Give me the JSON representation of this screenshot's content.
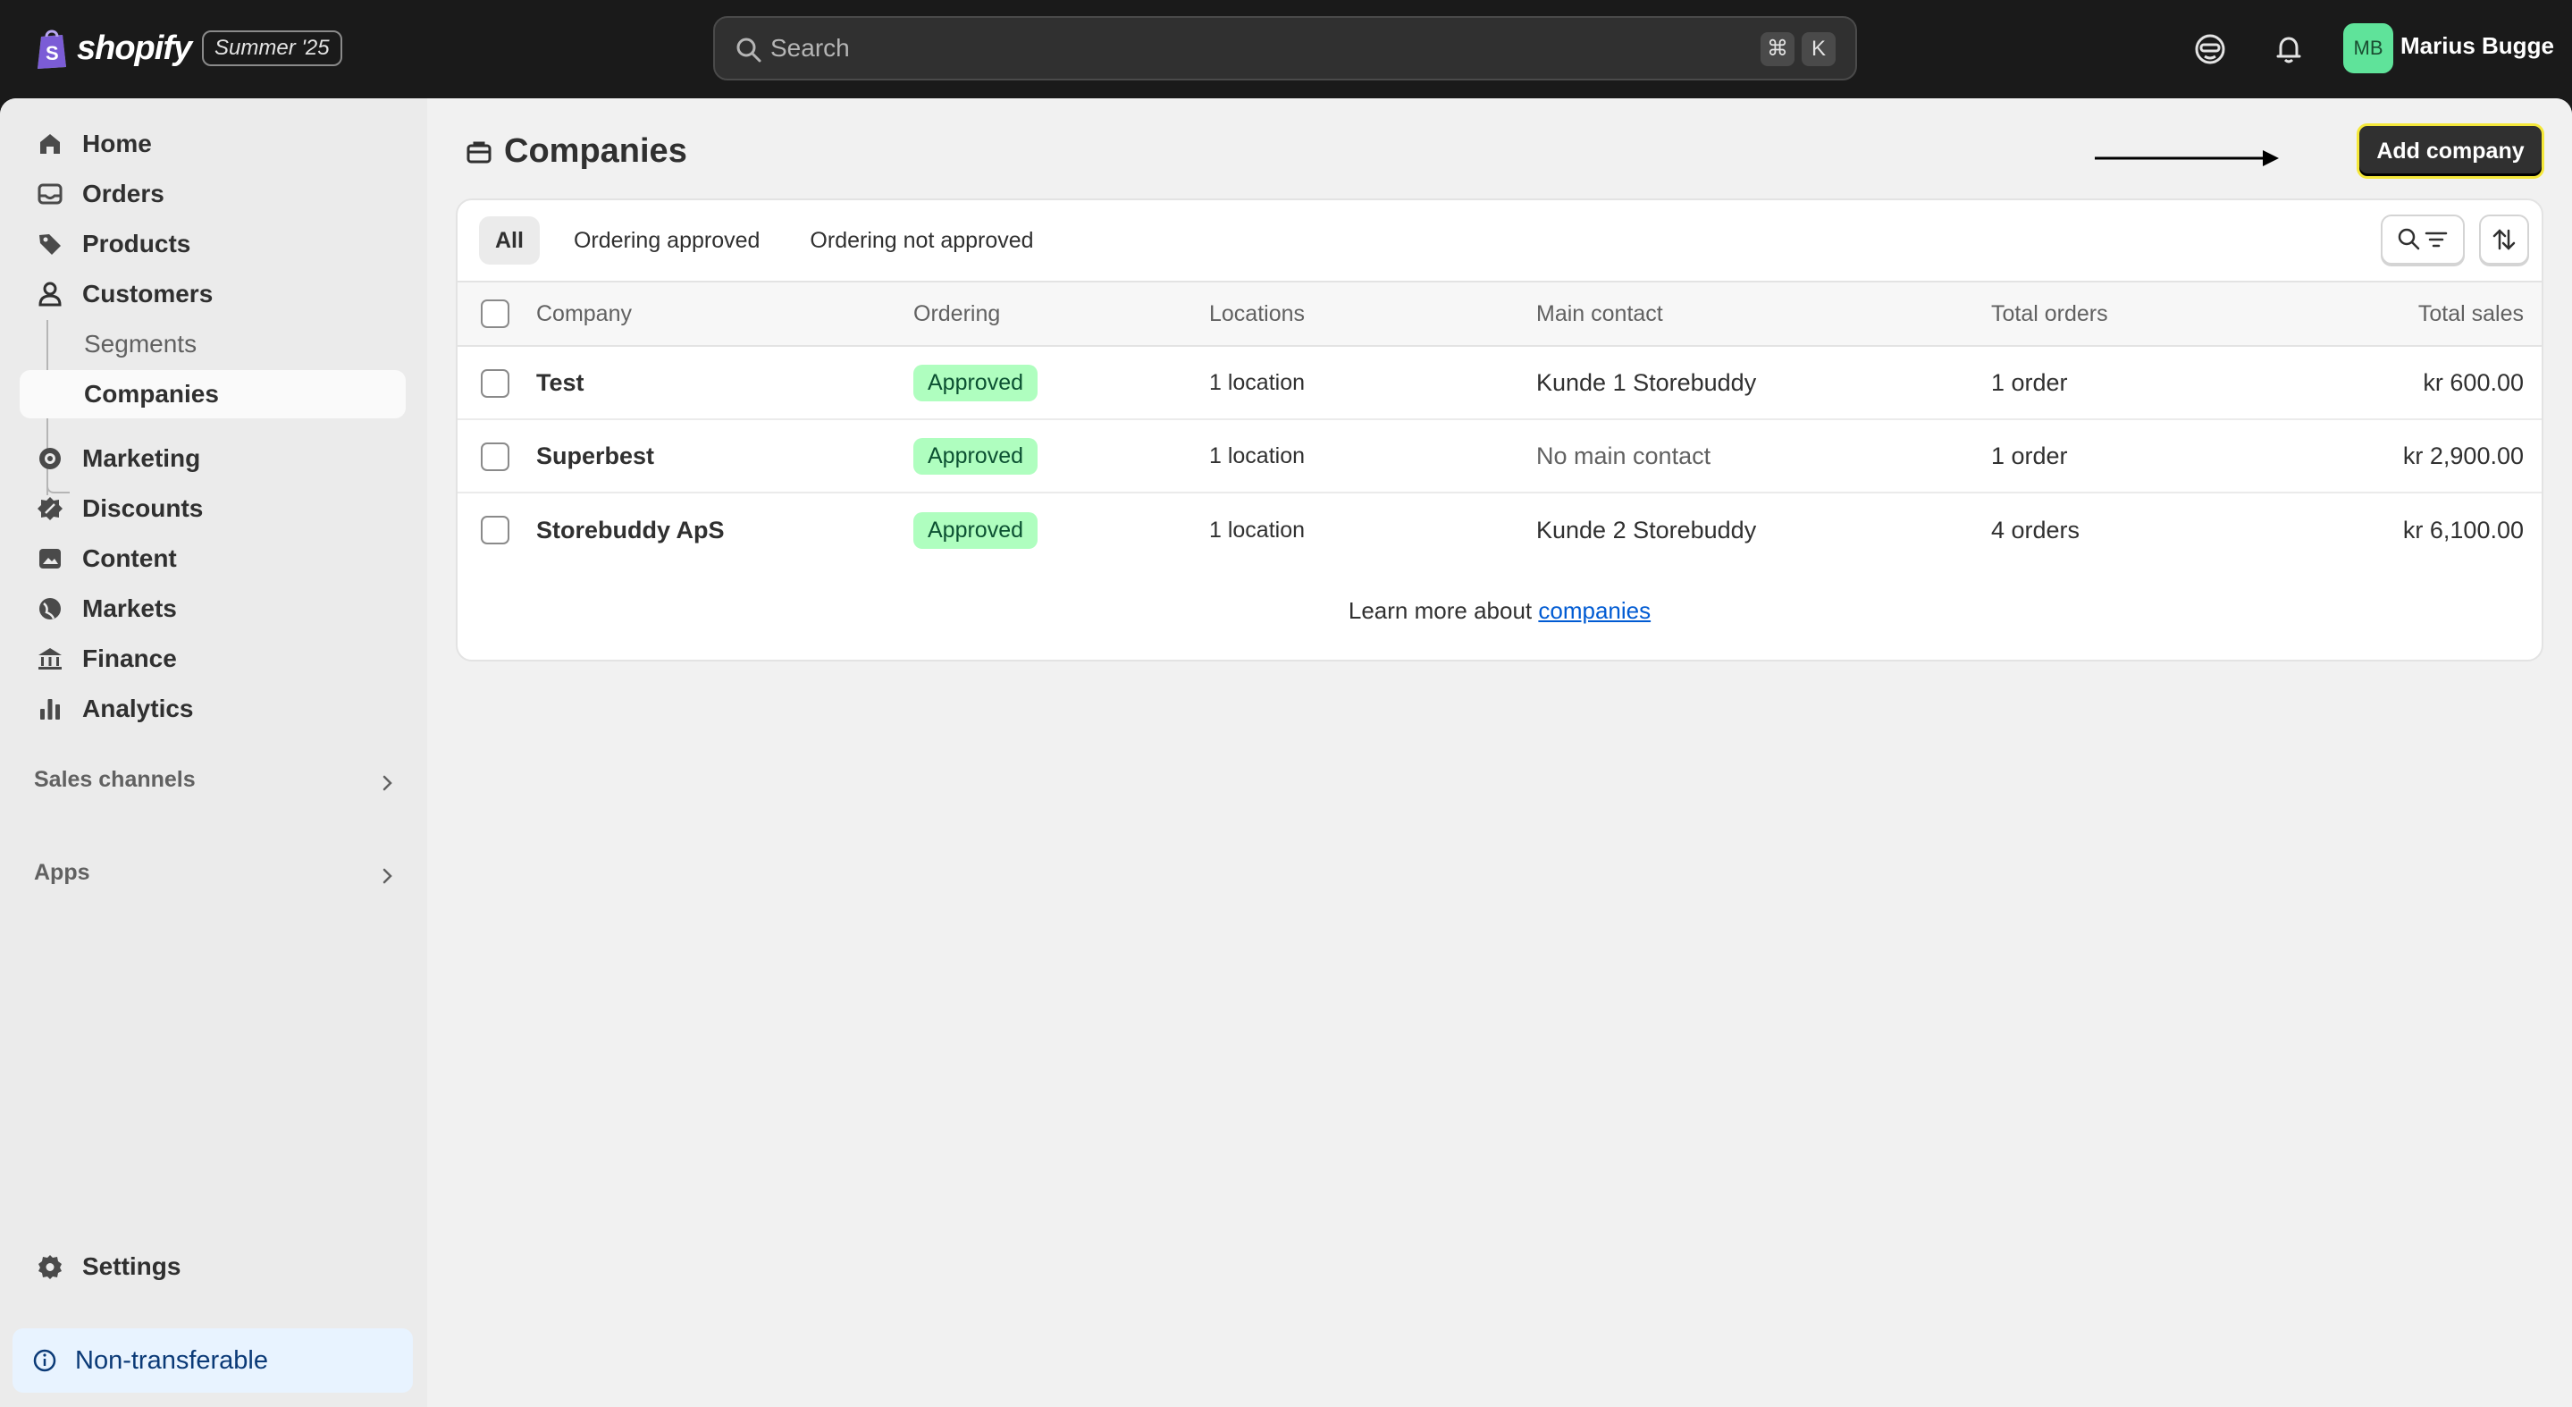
{
  "topbar": {
    "brand": "shopify",
    "edition": "Summer '25",
    "search_placeholder": "Search",
    "shortcut_cmd": "⌘",
    "shortcut_key": "K",
    "user_initials": "MB",
    "user_name": "Marius Bugge"
  },
  "sidebar": {
    "items": [
      {
        "label": "Home",
        "icon": "home-icon"
      },
      {
        "label": "Orders",
        "icon": "inbox-icon"
      },
      {
        "label": "Products",
        "icon": "tag-icon"
      },
      {
        "label": "Customers",
        "icon": "person-icon"
      },
      {
        "label": "Segments"
      },
      {
        "label": "Companies"
      },
      {
        "label": "Marketing",
        "icon": "target-icon"
      },
      {
        "label": "Discounts",
        "icon": "discount-icon"
      },
      {
        "label": "Content",
        "icon": "image-icon"
      },
      {
        "label": "Markets",
        "icon": "globe-icon"
      },
      {
        "label": "Finance",
        "icon": "bank-icon"
      },
      {
        "label": "Analytics",
        "icon": "bar-chart-icon"
      }
    ],
    "sales_channels": "Sales channels",
    "apps": "Apps",
    "settings": "Settings",
    "non_transferable": "Non-transferable"
  },
  "main": {
    "title": "Companies",
    "add_button": "Add company",
    "tabs": [
      "All",
      "Ordering approved",
      "Ordering not approved"
    ],
    "columns": [
      "Company",
      "Ordering",
      "Locations",
      "Main contact",
      "Total orders",
      "Total sales"
    ],
    "rows": [
      {
        "company": "Test",
        "ordering": "Approved",
        "locations": "1 location",
        "contact": "Kunde 1 Storebuddy",
        "orders": "1 order",
        "sales": "kr 600.00"
      },
      {
        "company": "Superbest",
        "ordering": "Approved",
        "locations": "1 location",
        "contact": "No main contact",
        "orders": "1 order",
        "sales": "kr 2,900.00"
      },
      {
        "company": "Storebuddy ApS",
        "ordering": "Approved",
        "locations": "1 location",
        "contact": "Kunde 2 Storebuddy",
        "orders": "4 orders",
        "sales": "kr 6,100.00"
      }
    ],
    "learn_more": "Learn more about",
    "learn_link": "companies"
  },
  "colors": {
    "topbar": "#1a1a1a",
    "badge_bg": "#affebf",
    "link": "#005bd3",
    "avatar": "#5fe39a"
  }
}
